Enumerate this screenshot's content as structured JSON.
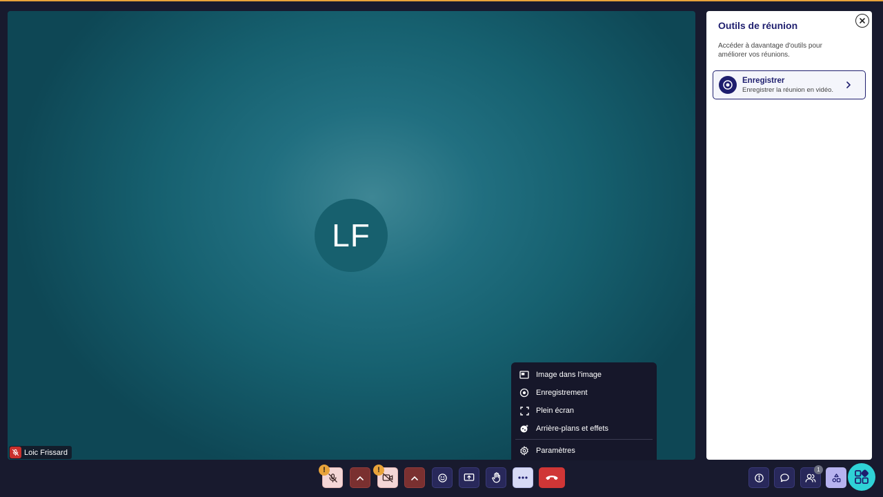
{
  "participant": {
    "initials": "LF",
    "name": "Loic Frissard"
  },
  "panel": {
    "title": "Outils de réunion",
    "description": "Accéder à davantage d'outils pour améliorer vos réunions.",
    "tool": {
      "title": "Enregistrer",
      "subtitle": "Enregistrer la réunion en vidéo."
    }
  },
  "menu": {
    "items": [
      {
        "label": "Image dans l'image",
        "icon": "picture-in-picture-icon"
      },
      {
        "label": "Enregistrement",
        "icon": "record-icon"
      },
      {
        "label": "Plein écran",
        "icon": "fullscreen-icon"
      },
      {
        "label": "Arrière-plans et effets",
        "icon": "effects-icon"
      },
      {
        "label": "Paramètres",
        "icon": "settings-icon"
      }
    ]
  },
  "toolbar": {
    "warning_symbol": "!",
    "participants_count": "1"
  },
  "colors": {
    "background": "#181a2e",
    "accent_navy": "#1e1e6e",
    "warning": "#e8a33a",
    "hangup": "#d03636",
    "apps": "#2fd2d6"
  }
}
